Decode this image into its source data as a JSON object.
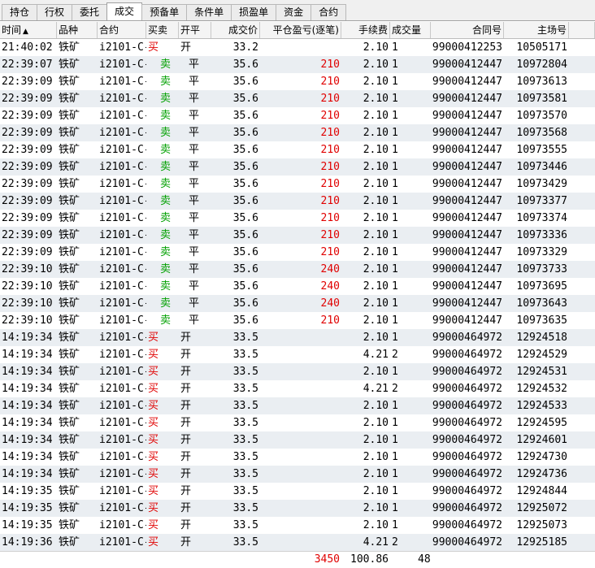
{
  "tabs": [
    {
      "label": "持仓",
      "active": false
    },
    {
      "label": "行权",
      "active": false
    },
    {
      "label": "委托",
      "active": false
    },
    {
      "label": "成交",
      "active": true
    },
    {
      "label": "预备单",
      "active": false
    },
    {
      "label": "条件单",
      "active": false
    },
    {
      "label": "损盈单",
      "active": false
    },
    {
      "label": "资金",
      "active": false
    },
    {
      "label": "合约",
      "active": false
    }
  ],
  "columns": [
    {
      "label": "时间",
      "align": "l"
    },
    {
      "label": "品种",
      "align": "l"
    },
    {
      "label": "合约",
      "align": "l"
    },
    {
      "label": "买卖",
      "align": "l"
    },
    {
      "label": "开平",
      "align": "l"
    },
    {
      "label": "成交价",
      "align": "r"
    },
    {
      "label": "平仓盈亏(逐笔)",
      "align": "r"
    },
    {
      "label": "手续费",
      "align": "r"
    },
    {
      "label": "成交量",
      "align": "l"
    },
    {
      "label": "合同号",
      "align": "r"
    },
    {
      "label": "主场号",
      "align": "r"
    }
  ],
  "sort_indicator": "▲",
  "colors": {
    "buy": "#e00000",
    "sell": "#00a000",
    "profit": "#e00000"
  },
  "rows": [
    [
      "21:40:02",
      "铁矿",
      "i2101-C-",
      "买",
      "开",
      "33.2",
      "",
      "2.10",
      "1",
      "99000412253",
      "10505171"
    ],
    [
      "22:39:07",
      "铁矿",
      "i2101-C-",
      "卖",
      "平",
      "35.6",
      "210",
      "2.10",
      "1",
      "99000412447",
      "10972804"
    ],
    [
      "22:39:09",
      "铁矿",
      "i2101-C-",
      "卖",
      "平",
      "35.6",
      "210",
      "2.10",
      "1",
      "99000412447",
      "10973613"
    ],
    [
      "22:39:09",
      "铁矿",
      "i2101-C-",
      "卖",
      "平",
      "35.6",
      "210",
      "2.10",
      "1",
      "99000412447",
      "10973581"
    ],
    [
      "22:39:09",
      "铁矿",
      "i2101-C-",
      "卖",
      "平",
      "35.6",
      "210",
      "2.10",
      "1",
      "99000412447",
      "10973570"
    ],
    [
      "22:39:09",
      "铁矿",
      "i2101-C-",
      "卖",
      "平",
      "35.6",
      "210",
      "2.10",
      "1",
      "99000412447",
      "10973568"
    ],
    [
      "22:39:09",
      "铁矿",
      "i2101-C-",
      "卖",
      "平",
      "35.6",
      "210",
      "2.10",
      "1",
      "99000412447",
      "10973555"
    ],
    [
      "22:39:09",
      "铁矿",
      "i2101-C-",
      "卖",
      "平",
      "35.6",
      "210",
      "2.10",
      "1",
      "99000412447",
      "10973446"
    ],
    [
      "22:39:09",
      "铁矿",
      "i2101-C-",
      "卖",
      "平",
      "35.6",
      "210",
      "2.10",
      "1",
      "99000412447",
      "10973429"
    ],
    [
      "22:39:09",
      "铁矿",
      "i2101-C-",
      "卖",
      "平",
      "35.6",
      "210",
      "2.10",
      "1",
      "99000412447",
      "10973377"
    ],
    [
      "22:39:09",
      "铁矿",
      "i2101-C-",
      "卖",
      "平",
      "35.6",
      "210",
      "2.10",
      "1",
      "99000412447",
      "10973374"
    ],
    [
      "22:39:09",
      "铁矿",
      "i2101-C-",
      "卖",
      "平",
      "35.6",
      "210",
      "2.10",
      "1",
      "99000412447",
      "10973336"
    ],
    [
      "22:39:09",
      "铁矿",
      "i2101-C-",
      "卖",
      "平",
      "35.6",
      "210",
      "2.10",
      "1",
      "99000412447",
      "10973329"
    ],
    [
      "22:39:10",
      "铁矿",
      "i2101-C-",
      "卖",
      "平",
      "35.6",
      "240",
      "2.10",
      "1",
      "99000412447",
      "10973733"
    ],
    [
      "22:39:10",
      "铁矿",
      "i2101-C-",
      "卖",
      "平",
      "35.6",
      "240",
      "2.10",
      "1",
      "99000412447",
      "10973695"
    ],
    [
      "22:39:10",
      "铁矿",
      "i2101-C-",
      "卖",
      "平",
      "35.6",
      "240",
      "2.10",
      "1",
      "99000412447",
      "10973643"
    ],
    [
      "22:39:10",
      "铁矿",
      "i2101-C-",
      "卖",
      "平",
      "35.6",
      "210",
      "2.10",
      "1",
      "99000412447",
      "10973635"
    ],
    [
      "14:19:34",
      "铁矿",
      "i2101-C-",
      "买",
      "开",
      "33.5",
      "",
      "2.10",
      "1",
      "99000464972",
      "12924518"
    ],
    [
      "14:19:34",
      "铁矿",
      "i2101-C-",
      "买",
      "开",
      "33.5",
      "",
      "4.21",
      "2",
      "99000464972",
      "12924529"
    ],
    [
      "14:19:34",
      "铁矿",
      "i2101-C-",
      "买",
      "开",
      "33.5",
      "",
      "2.10",
      "1",
      "99000464972",
      "12924531"
    ],
    [
      "14:19:34",
      "铁矿",
      "i2101-C-",
      "买",
      "开",
      "33.5",
      "",
      "4.21",
      "2",
      "99000464972",
      "12924532"
    ],
    [
      "14:19:34",
      "铁矿",
      "i2101-C-",
      "买",
      "开",
      "33.5",
      "",
      "2.10",
      "1",
      "99000464972",
      "12924533"
    ],
    [
      "14:19:34",
      "铁矿",
      "i2101-C-",
      "买",
      "开",
      "33.5",
      "",
      "2.10",
      "1",
      "99000464972",
      "12924595"
    ],
    [
      "14:19:34",
      "铁矿",
      "i2101-C-",
      "买",
      "开",
      "33.5",
      "",
      "2.10",
      "1",
      "99000464972",
      "12924601"
    ],
    [
      "14:19:34",
      "铁矿",
      "i2101-C-",
      "买",
      "开",
      "33.5",
      "",
      "2.10",
      "1",
      "99000464972",
      "12924730"
    ],
    [
      "14:19:34",
      "铁矿",
      "i2101-C-",
      "买",
      "开",
      "33.5",
      "",
      "2.10",
      "1",
      "99000464972",
      "12924736"
    ],
    [
      "14:19:35",
      "铁矿",
      "i2101-C-",
      "买",
      "开",
      "33.5",
      "",
      "2.10",
      "1",
      "99000464972",
      "12924844"
    ],
    [
      "14:19:35",
      "铁矿",
      "i2101-C-",
      "买",
      "开",
      "33.5",
      "",
      "2.10",
      "1",
      "99000464972",
      "12925072"
    ],
    [
      "14:19:35",
      "铁矿",
      "i2101-C-",
      "买",
      "开",
      "33.5",
      "",
      "2.10",
      "1",
      "99000464972",
      "12925073"
    ],
    [
      "14:19:36",
      "铁矿",
      "i2101-C-",
      "买",
      "开",
      "33.5",
      "",
      "4.21",
      "2",
      "99000464972",
      "12925185"
    ]
  ],
  "totals": {
    "profit": "3450",
    "fee": "100.86",
    "volume": "48"
  }
}
